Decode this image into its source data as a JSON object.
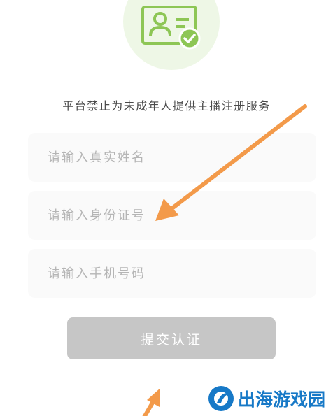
{
  "notice": "平台禁止为未成年人提供主播注册服务",
  "form": {
    "name_placeholder": "请输入真实姓名",
    "id_placeholder": "请输入身份证号",
    "phone_placeholder": "请输入手机号码",
    "submit_label": "提交认证"
  },
  "header": {
    "icon": "id-card-verified-icon"
  },
  "annotations": {
    "arrow_color": "#f39a4a",
    "arrows": [
      "arrow-to-id-field",
      "arrow-to-submit"
    ]
  },
  "watermark": {
    "text": "出海游戏园",
    "color": "#1779c7"
  },
  "colors": {
    "accent_green": "#8dc655",
    "header_circle": "#eef7e6",
    "submit_disabled": "#c6c6c6"
  }
}
